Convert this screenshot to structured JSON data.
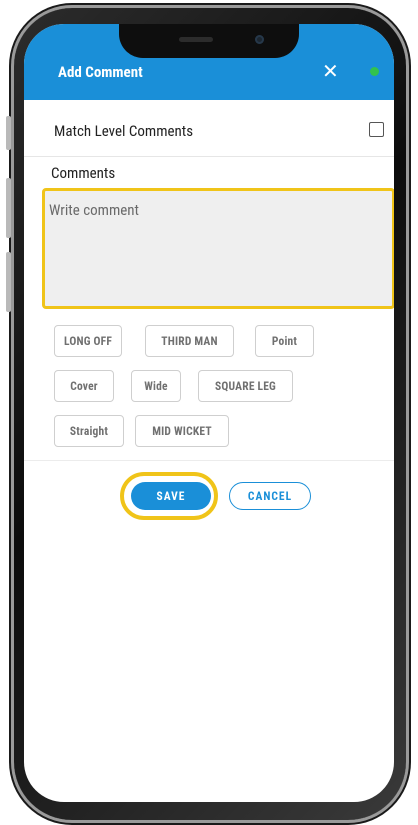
{
  "modal": {
    "title": "Add Comment",
    "close_icon": "close-icon",
    "status_dot_color": "#32c24d",
    "header_color": "#1a8fd8"
  },
  "match_level": {
    "label": "Match Level Comments",
    "checked": false
  },
  "comments": {
    "label": "Comments",
    "placeholder": "Write comment",
    "value": ""
  },
  "chips": [
    "LONG OFF",
    "THIRD MAN",
    "Point",
    "Cover",
    "Wide",
    "SQUARE LEG",
    "Straight",
    "MID WICKET"
  ],
  "actions": {
    "save_label": "SAVE",
    "cancel_label": "CANCEL"
  },
  "highlight_color": "#f0c419"
}
